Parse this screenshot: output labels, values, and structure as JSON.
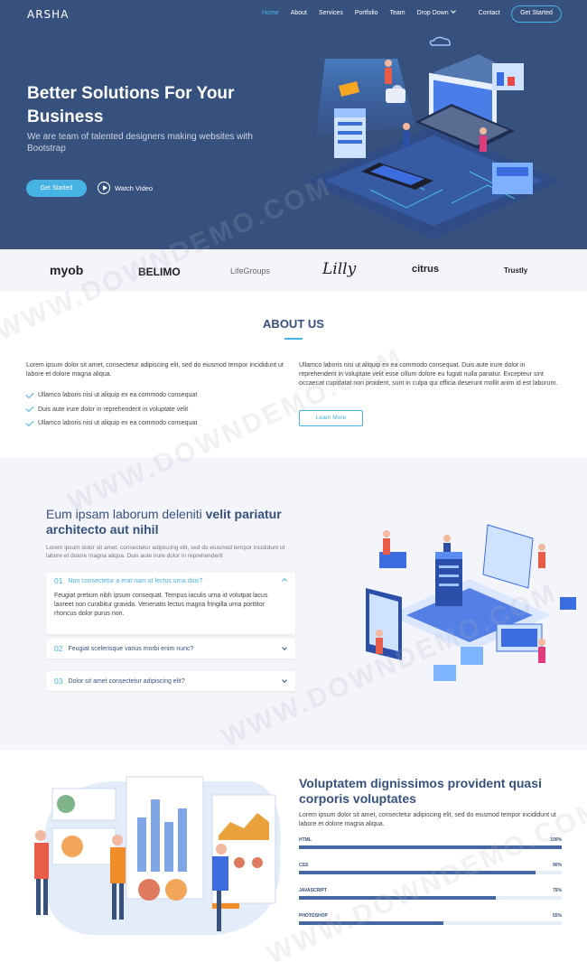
{
  "header": {
    "logo": "ARSHA",
    "menu": [
      {
        "label": "Home",
        "active": true
      },
      {
        "label": "About"
      },
      {
        "label": "Services"
      },
      {
        "label": "Portfolio"
      },
      {
        "label": "Team"
      },
      {
        "label": "Drop Down"
      },
      {
        "label": "Contact"
      }
    ],
    "cta": "Get Started"
  },
  "hero": {
    "title": "Better Solutions For Your Business",
    "subtitle": "We are team of talented designers making websites with Bootstrap",
    "start_label": "Get Started",
    "watch_label": "Watch Video"
  },
  "clients": [
    "myob",
    "BELIMO",
    "LifeGroups",
    "Lilly",
    "citrus",
    "Trustly"
  ],
  "about": {
    "title": "ABOUT US",
    "left_text": "Lorem ipsum dolor sit amet, consectetur adipiscing elit, sed do eiusmod tempor incididunt ut labore et dolore magna aliqua.",
    "checks": [
      "Ullamco laboris nisi ut aliquip ex ea commodo consequat",
      "Duis aute irure dolor in reprehenderit in voluptate velit",
      "Ullamco laboris nisi ut aliquip ex ea commodo consequat"
    ],
    "right_text": "Ullamco laboris nisi ut aliquip ex ea commodo consequat. Duis aute irure dolor in reprehenderit in voluptate velit esse cillum dolore eu fugiat nulla pariatur. Excepteur sint occaecat cupidatat non proident, sunt in culpa qui officia deserunt mollit anim id est laborum.",
    "learn_more": "Learn More"
  },
  "why": {
    "title_plain": "Eum ipsam laborum deleniti ",
    "title_bold": "velit pariatur architecto aut nihil",
    "desc": "Lorem ipsum dolor sit amet, consectetur adipiscing elit, sed do eiusmod tempor incididunt ut labore et dolore magna aliqua. Duis aute irure dolor in reprehenderit",
    "faq": [
      {
        "num": "01",
        "q": "Non consectetur a erat nam at lectus urna duis?",
        "a": "Feugiat pretium nibh ipsum consequat. Tempus iaculis urna id volutpat lacus laoreet non curabitur gravida. Venenatis lectus magna fringilla urna porttitor rhoncus dolor purus non."
      },
      {
        "num": "02",
        "q": "Feugiat scelerisque varius morbi enim nunc?"
      },
      {
        "num": "03",
        "q": "Dolor sit amet consectetur adipiscing elit?"
      }
    ]
  },
  "skills": {
    "title": "Voluptatem dignissimos provident quasi corporis voluptates",
    "desc": "Lorem ipsum dolor sit amet, consectetur adipiscing elit, sed do eiusmod tempor incididunt ut labore et dolore magna aliqua.",
    "items": [
      {
        "name": "HTML",
        "pct_label": "100%",
        "pct": 100
      },
      {
        "name": "CSS",
        "pct_label": "90%",
        "pct": 90
      },
      {
        "name": "JAVASCRIPT",
        "pct_label": "75%",
        "pct": 75
      },
      {
        "name": "PHOTOSHOP",
        "pct_label": "55%",
        "pct": 55
      }
    ]
  },
  "watermark": "WWW.DOWNDEMO.COM",
  "colors": {
    "primary": "#37517e",
    "accent": "#47b2e4",
    "light": "#f3f5fa"
  }
}
